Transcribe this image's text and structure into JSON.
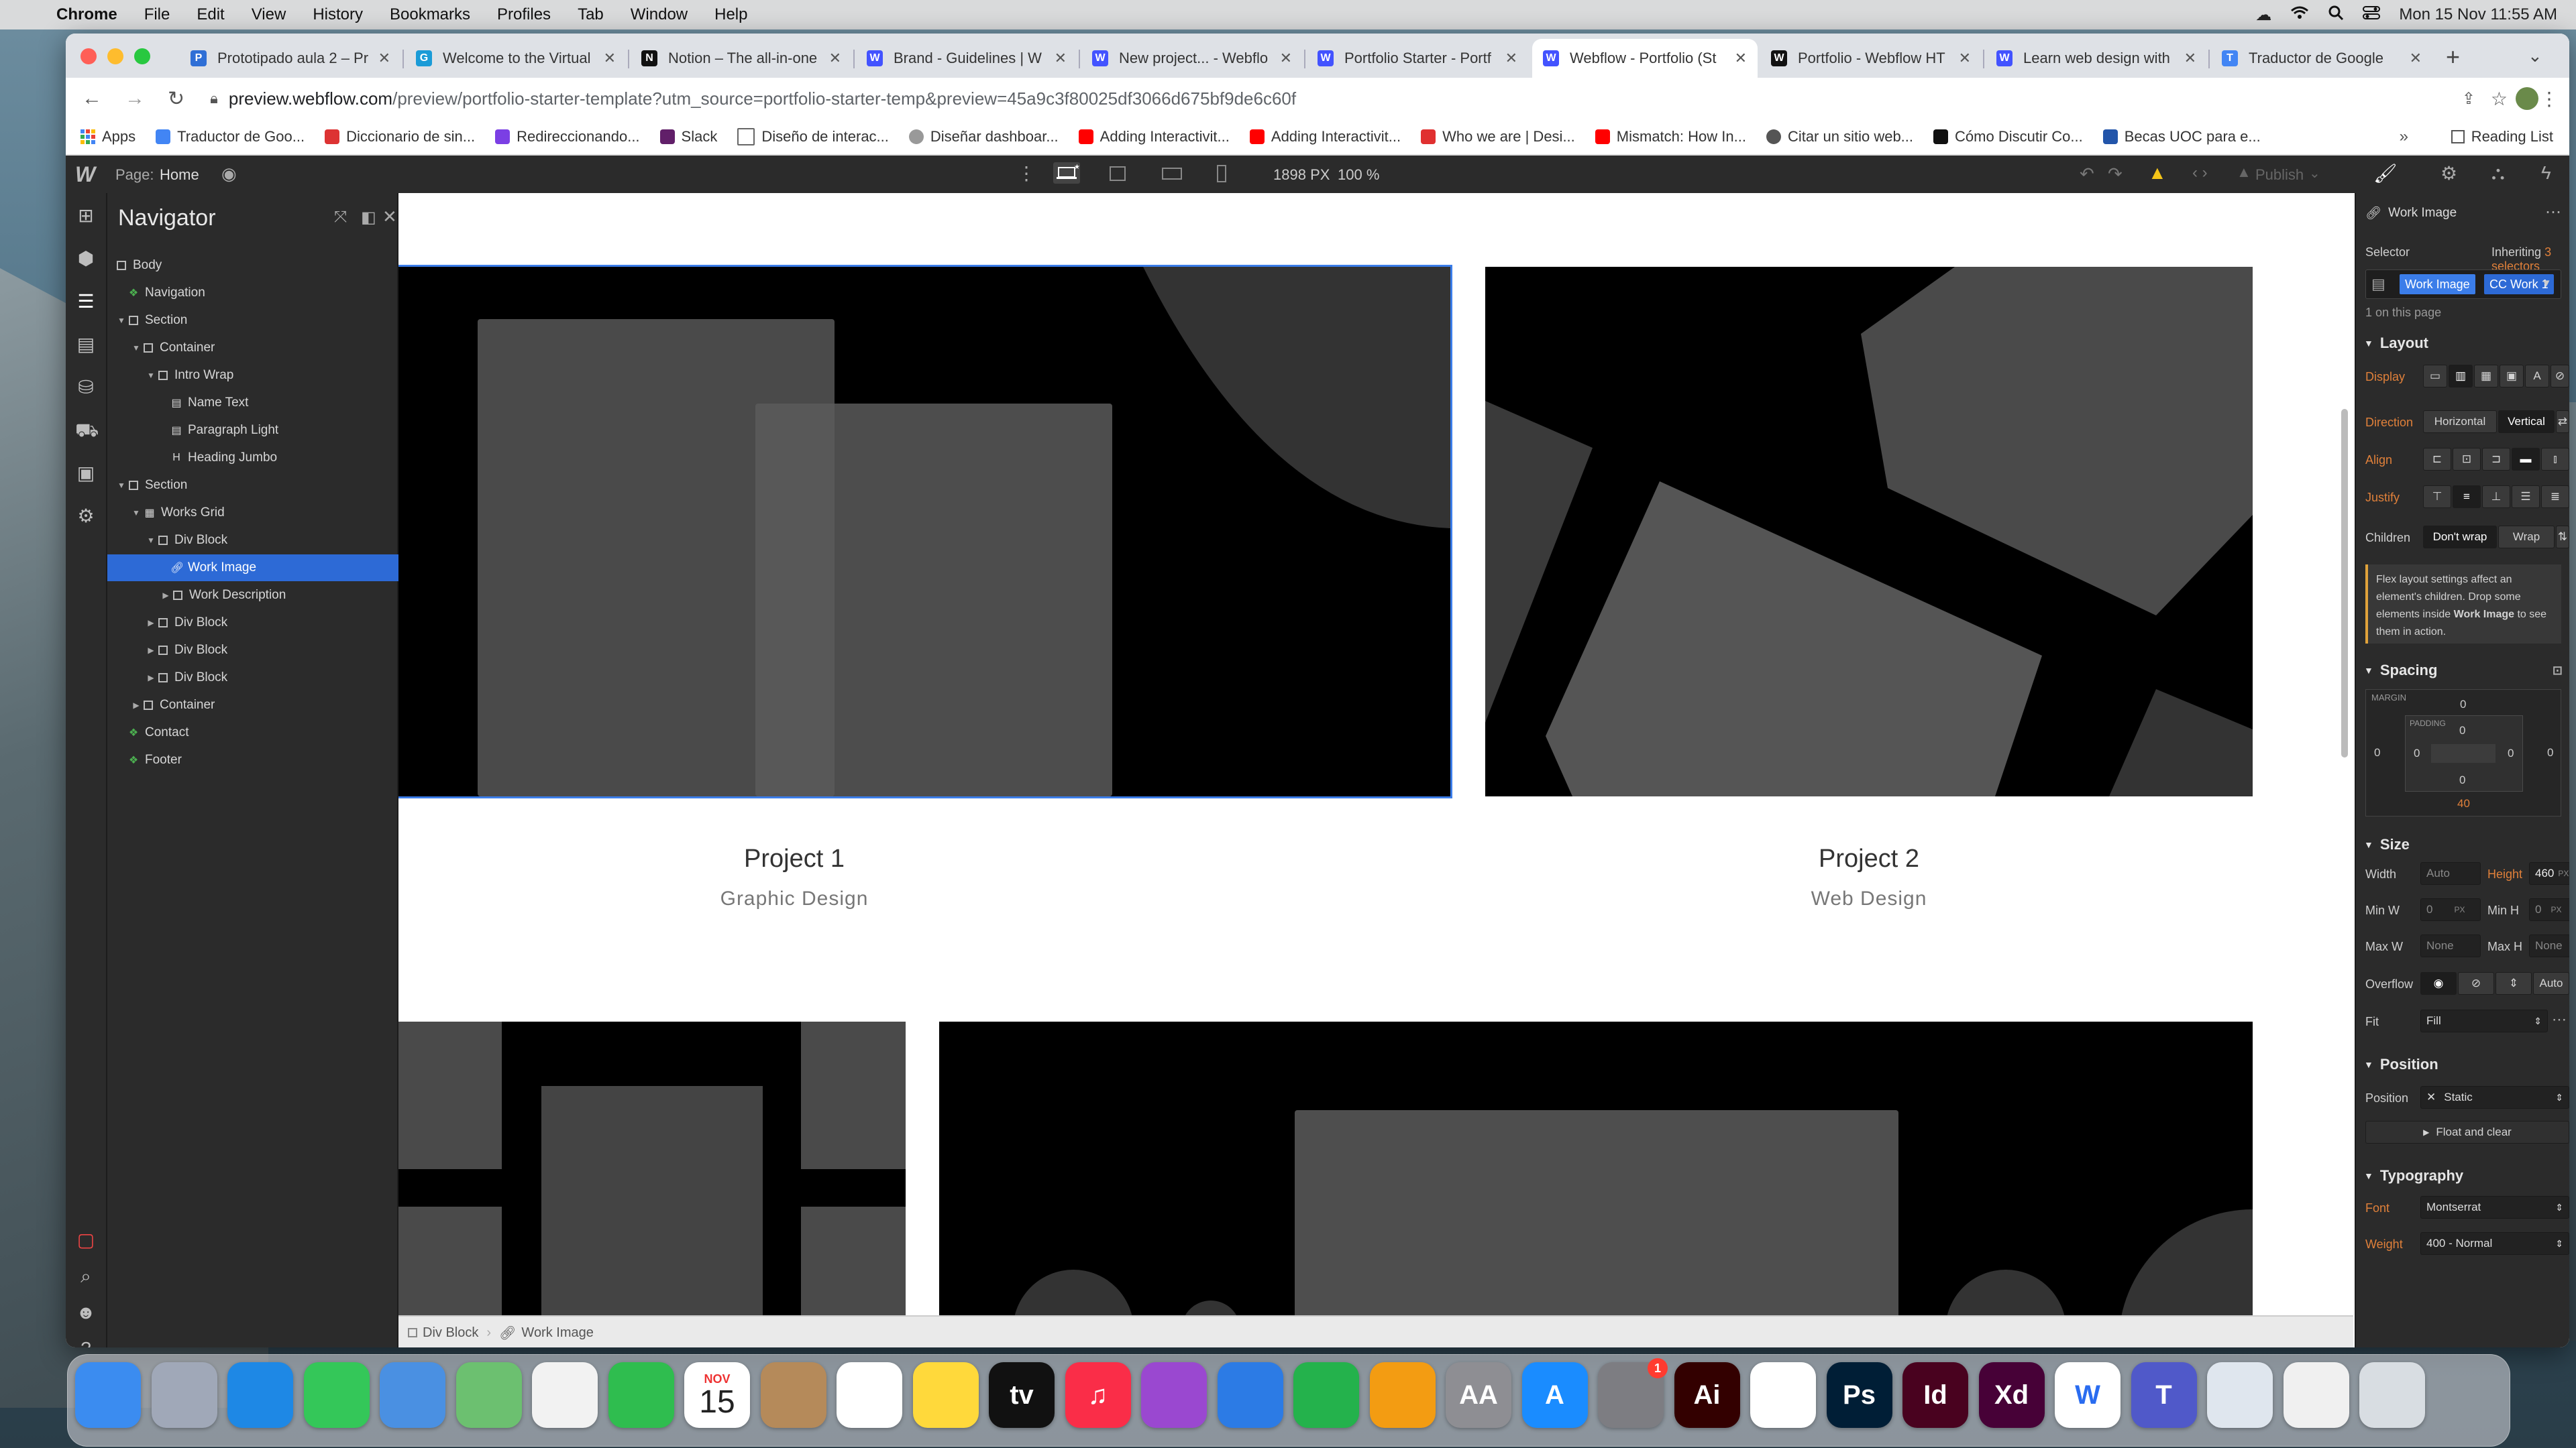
{
  "menubar": {
    "app": "Chrome",
    "items": [
      "File",
      "Edit",
      "View",
      "History",
      "Bookmarks",
      "Profiles",
      "Tab",
      "Window",
      "Help"
    ],
    "datetime": "Mon 15 Nov  11:55 AM"
  },
  "tabs": [
    {
      "title": "Prototipado aula 2 – Pr",
      "color": "#2f6fd6",
      "glyph": "P"
    },
    {
      "title": "Welcome to the Virtual",
      "color": "#1a9bd7",
      "glyph": "G"
    },
    {
      "title": "Notion – The all-in-one",
      "color": "#111111",
      "glyph": "N"
    },
    {
      "title": "Brand - Guidelines | W",
      "color": "#4353ff",
      "glyph": "W"
    },
    {
      "title": "New project... - Webflo",
      "color": "#4353ff",
      "glyph": "W"
    },
    {
      "title": "Portfolio Starter - Portf",
      "color": "#4353ff",
      "glyph": "W"
    },
    {
      "title": "Webflow - Portfolio (St",
      "color": "#4353ff",
      "glyph": "W"
    },
    {
      "title": "Portfolio - Webflow HT",
      "color": "#111111",
      "glyph": "W"
    },
    {
      "title": "Learn web design with",
      "color": "#4353ff",
      "glyph": "W"
    },
    {
      "title": "Traductor de Google",
      "color": "#4285f4",
      "glyph": "T"
    }
  ],
  "address": {
    "host": "preview.webflow.com",
    "path": "/preview/portfolio-starter-template?utm_source=portfolio-starter-temp&preview=45a9c3f80025df3066d675bf9de6c60f"
  },
  "bookmarks": [
    {
      "label": "Apps",
      "color": "#4285f4"
    },
    {
      "label": "Traductor de Goo...",
      "color": "#4285f4"
    },
    {
      "label": "Diccionario de sin...",
      "color": "#d33"
    },
    {
      "label": "Redireccionando...",
      "color": "#7b3fe4"
    },
    {
      "label": "Slack",
      "color": "#611f69"
    },
    {
      "label": "Diseño de interac...",
      "color": "#888888"
    },
    {
      "label": "Diseñar dashboar...",
      "color": "#999999"
    },
    {
      "label": "Adding Interactivit...",
      "color": "#ff0000"
    },
    {
      "label": "Adding Interactivit...",
      "color": "#ff0000"
    },
    {
      "label": "Who we are | Desi...",
      "color": "#e03030"
    },
    {
      "label": "Mismatch: How In...",
      "color": "#ff0000"
    },
    {
      "label": "Citar un sitio web...",
      "color": "#555555"
    },
    {
      "label": "Cómo Discutir Co...",
      "color": "#111111"
    },
    {
      "label": "Becas UOC para e...",
      "color": "#2255aa"
    }
  ],
  "reading_list": "Reading List",
  "designer": {
    "page_label": "Page:",
    "page_name": "Home",
    "canvas_width": "1898",
    "canvas_unit": "PX",
    "zoom": "100 %",
    "publish": "Publish"
  },
  "navigator": {
    "title": "Navigator",
    "rows": [
      {
        "label": "Body",
        "kind": "box"
      },
      {
        "label": "Navigation",
        "kind": "symbol"
      },
      {
        "label": "Section",
        "kind": "box"
      },
      {
        "label": "Container",
        "kind": "box"
      },
      {
        "label": "Intro Wrap",
        "kind": "box"
      },
      {
        "label": "Name Text",
        "kind": "text"
      },
      {
        "label": "Paragraph Light",
        "kind": "text"
      },
      {
        "label": "Heading Jumbo",
        "kind": "heading"
      },
      {
        "label": "Section",
        "kind": "box"
      },
      {
        "label": "Works Grid",
        "kind": "grid"
      },
      {
        "label": "Div Block",
        "kind": "box"
      },
      {
        "label": "Work Image",
        "kind": "link"
      },
      {
        "label": "Work Description",
        "kind": "box"
      },
      {
        "label": "Div Block",
        "kind": "box"
      },
      {
        "label": "Div Block",
        "kind": "box"
      },
      {
        "label": "Div Block",
        "kind": "box"
      },
      {
        "label": "Container",
        "kind": "box"
      },
      {
        "label": "Contact",
        "kind": "symbol"
      },
      {
        "label": "Footer",
        "kind": "symbol"
      }
    ]
  },
  "canvas": {
    "projects": [
      {
        "title": "Project 1",
        "subtitle": "Graphic Design"
      },
      {
        "title": "Project 2",
        "subtitle": "Web Design"
      }
    ]
  },
  "breadcrumb": [
    "Div Block",
    "Work Image"
  ],
  "style_panel": {
    "element_name": "Work Image",
    "selector_label": "Selector",
    "inheriting_prefix": "Inheriting",
    "inheriting_link": "3 selectors",
    "selector_chips": [
      "Work Image",
      "CC Work 1"
    ],
    "on_page": "1 on this page",
    "layout": {
      "heading": "Layout",
      "display_label": "Display",
      "direction_label": "Direction",
      "direction_options": [
        "Horizontal",
        "Vertical"
      ],
      "align_label": "Align",
      "justify_label": "Justify",
      "children_label": "Children",
      "children_options": [
        "Don't wrap",
        "Wrap"
      ],
      "hint_pre": "Flex layout settings affect an element's children. Drop some elements inside",
      "hint_element": "Work Image",
      "hint_post": "to see them in action."
    },
    "spacing": {
      "heading": "Spacing",
      "margin_label": "MARGIN",
      "padding_label": "PADDING",
      "margin": [
        "0",
        "0",
        "40",
        "0"
      ],
      "padding": [
        "0",
        "0",
        "0",
        "0"
      ]
    },
    "size": {
      "heading": "Size",
      "width_label": "Width",
      "width_value": "Auto",
      "height_label": "Height",
      "height_value": "460",
      "height_unit": "PX",
      "minw_label": "Min W",
      "minw_value": "0",
      "minw_unit": "PX",
      "minh_label": "Min H",
      "minh_value": "0",
      "minh_unit": "PX",
      "maxw_label": "Max W",
      "maxw_value": "None",
      "maxh_label": "Max H",
      "maxh_value": "None",
      "overflow_label": "Overflow",
      "overflow_auto": "Auto",
      "fit_label": "Fit",
      "fit_value": "Fill"
    },
    "position": {
      "heading": "Position",
      "label": "Position",
      "value": "Static",
      "float_clear": "Float and clear"
    },
    "typography": {
      "heading": "Typography",
      "font_label": "Font",
      "font_value": "Montserrat",
      "weight_label": "Weight",
      "weight_value": "400 - Normal"
    }
  },
  "dock": [
    {
      "name": "finder",
      "color": "#3b8cf0",
      "glyph": ""
    },
    {
      "name": "launchpad",
      "color": "#a0a8b8",
      "glyph": ""
    },
    {
      "name": "safari",
      "color": "#1e88e5",
      "glyph": ""
    },
    {
      "name": "messages",
      "color": "#34c759",
      "glyph": ""
    },
    {
      "name": "mail",
      "color": "#4a90e2",
      "glyph": ""
    },
    {
      "name": "maps",
      "color": "#6cc070",
      "glyph": ""
    },
    {
      "name": "photos",
      "color": "#f2f2f2",
      "glyph": ""
    },
    {
      "name": "facetime",
      "color": "#2fbd4f",
      "glyph": ""
    },
    {
      "name": "calendar",
      "color": "#ffffff",
      "glyph": "15",
      "month": "NOV"
    },
    {
      "name": "contacts",
      "color": "#b58a5a",
      "glyph": ""
    },
    {
      "name": "reminders",
      "color": "#ffffff",
      "glyph": ""
    },
    {
      "name": "notes",
      "color": "#ffd93b",
      "glyph": ""
    },
    {
      "name": "apple-tv",
      "color": "#111111",
      "glyph": "tv"
    },
    {
      "name": "music",
      "color": "#fa2d48",
      "glyph": "♫"
    },
    {
      "name": "podcasts",
      "color": "#9a48d0",
      "glyph": ""
    },
    {
      "name": "keynote",
      "color": "#2c7be5",
      "glyph": ""
    },
    {
      "name": "numbers",
      "color": "#24b24c",
      "glyph": ""
    },
    {
      "name": "pages",
      "color": "#f39c12",
      "glyph": ""
    },
    {
      "name": "font-book",
      "color": "#8e8e93",
      "glyph": "AA"
    },
    {
      "name": "app-store",
      "color": "#1a8cff",
      "glyph": "A"
    },
    {
      "name": "system-preferences",
      "color": "#7d7d82",
      "glyph": "",
      "badge": "1"
    },
    {
      "name": "illustrator",
      "color": "#330000",
      "glyph": "Ai"
    },
    {
      "name": "chrome",
      "color": "#ffffff",
      "glyph": ""
    },
    {
      "name": "photoshop",
      "color": "#001e36",
      "glyph": "Ps"
    },
    {
      "name": "indesign",
      "color": "#49021f",
      "glyph": "Id"
    },
    {
      "name": "xd",
      "color": "#470137",
      "glyph": "Xd"
    },
    {
      "name": "webflow-app",
      "color": "#ffffff",
      "glyph": "W"
    },
    {
      "name": "teams",
      "color": "#5059c9",
      "glyph": "T"
    },
    {
      "name": "preview",
      "color": "#dfe6ee",
      "glyph": ""
    },
    {
      "name": "documents",
      "color": "#f0f0f0",
      "glyph": ""
    },
    {
      "name": "trash",
      "color": "#d8dde2",
      "glyph": ""
    }
  ]
}
